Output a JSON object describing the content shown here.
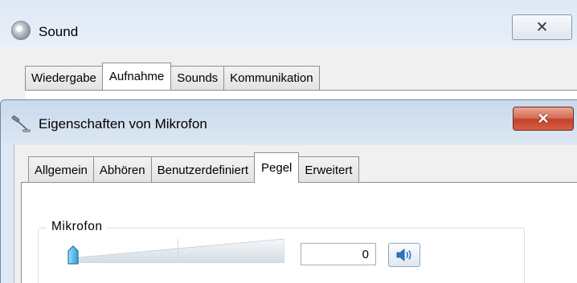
{
  "sound_window": {
    "title": "Sound",
    "close_label": "✕",
    "tabs": [
      {
        "label": "Wiedergabe",
        "selected": false
      },
      {
        "label": "Aufnahme",
        "selected": true
      },
      {
        "label": "Sounds",
        "selected": false
      },
      {
        "label": "Kommunikation",
        "selected": false
      }
    ]
  },
  "mic_dialog": {
    "title": "Eigenschaften von Mikrofon",
    "close_label": "✕",
    "tabs": [
      {
        "label": "Allgemein",
        "selected": false
      },
      {
        "label": "Abhören",
        "selected": false
      },
      {
        "label": "Benutzerdefiniert",
        "selected": false
      },
      {
        "label": "Pegel",
        "selected": true
      },
      {
        "label": "Erweitert",
        "selected": false
      }
    ],
    "levels": {
      "group_label": "Mikrofon",
      "level_value": "0",
      "slider_fraction": 0
    }
  },
  "colors": {
    "accent": "#3399ff",
    "close_red": "#c4412a"
  },
  "icons": [
    "sound-icon",
    "microphone-icon",
    "close-icon",
    "speaker-icon"
  ]
}
